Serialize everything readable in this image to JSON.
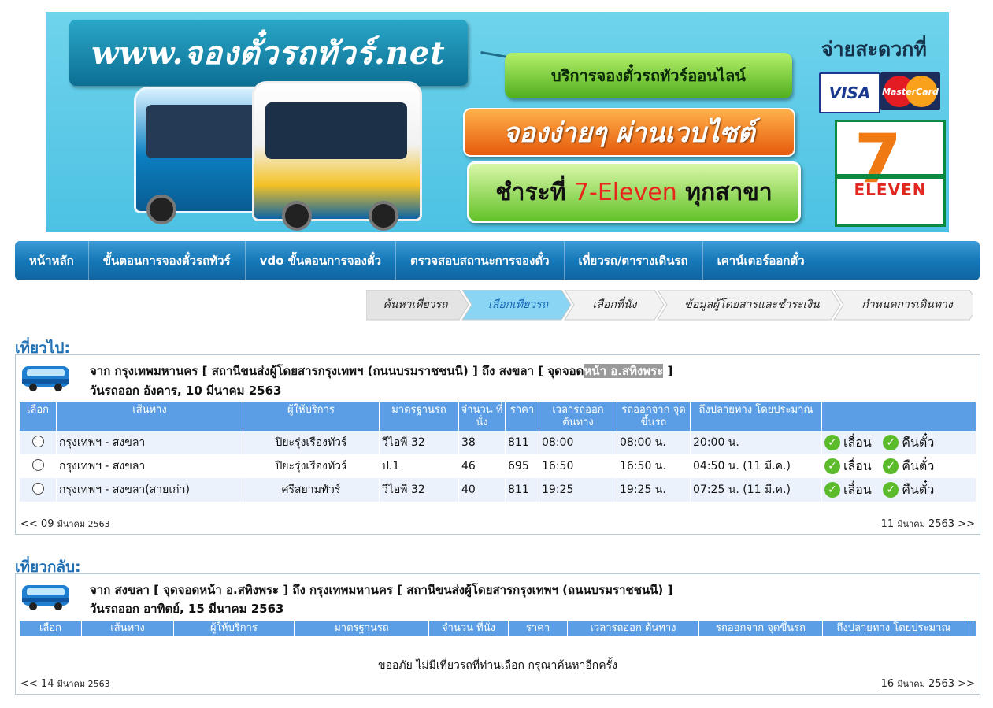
{
  "banner": {
    "site_name": "www.จองตั๋วรถทัวร์.net",
    "promo_service": "บริการจองตั๋วรถทัวร์ออนไลน์",
    "promo_easy": "จองง่ายๆ ผ่านเวบไซต์",
    "promo_pay_prefix": "ชำระที่",
    "promo_pay_store": "7-Eleven",
    "promo_pay_suffix": "ทุกสาขา",
    "pay_title": "จ่ายสะดวกที่",
    "card_visa": "VISA",
    "card_mastercard": "MasterCard",
    "seven_number": "7",
    "seven_name": "ELEVEN"
  },
  "nav": {
    "items": [
      "หน้าหลัก",
      "ขั้นตอนการจองตั๋วรถทัวร์",
      "vdo ขั้นตอนการจองตั๋ว",
      "ตรวจสอบสถานะการจองตั๋ว",
      "เที่ยวรถ/ตารางเดินรถ",
      "เคาน์เตอร์ออกตั๋ว"
    ]
  },
  "steps": [
    "ค้นหาเที่ยวรถ",
    "เลือกเที่ยวรถ",
    "เลือกที่นั่ง",
    "ข้อมูลผู้โดยสารและชำระเงิน",
    "กำหนดการเดินทาง"
  ],
  "outbound": {
    "title": "เที่ยวไป:",
    "route_prefix": "จาก กรุงเทพมหานคร [ สถานีขนส่งผู้โดยสารกรุงเทพฯ (ถนนบรมราชชนนี) ] ถึง สงขลา [ จุดจอด",
    "route_highlight": "หน้า อ.สทิงพระ",
    "route_suffix": " ]",
    "date": "วันรถออก อังคาร, 10 มีนาคม 2563",
    "headers": [
      "เลือก",
      "เส้นทาง",
      "ผู้ให้บริการ",
      "มาตรฐานรถ",
      "จำนวน ที่นั่ง",
      "ราคา",
      "เวลารถออก ต้นทาง",
      "รถออกจาก จุดขึ้นรถ",
      "ถึงปลายทาง โดยประมาณ",
      ""
    ],
    "rows": [
      {
        "route": "กรุงเทพฯ - สงขลา",
        "operator": "ปิยะรุ่งเรืองทัวร์",
        "standard": "วีไอพี 32",
        "seats": "38",
        "price": "811",
        "depart": "08:00",
        "board": "08:00 น.",
        "arrive": "20:00 น."
      },
      {
        "route": "กรุงเทพฯ - สงขลา",
        "operator": "ปิยะรุ่งเรืองทัวร์",
        "standard": "ป.1",
        "seats": "46",
        "price": "695",
        "depart": "16:50",
        "board": "16:50 น.",
        "arrive": "04:50 น. (11 มี.ค.)"
      },
      {
        "route": "กรุงเทพฯ - สงขลา(สายเก่า)",
        "operator": "ศรีสยามทัวร์",
        "standard": "วีไอพี 32",
        "seats": "40",
        "price": "811",
        "depart": "19:25",
        "board": "19:25 น.",
        "arrive": "07:25 น. (11 มี.ค.)"
      }
    ],
    "action_postpone": "เลื่อน",
    "action_refund": "คืนตั๋ว",
    "prev_prefix": "<< 09",
    "prev_month": "มีนาคม 2563",
    "next_day": "11",
    "next_month": "มีนาคม",
    "next_suffix": "2563 >>"
  },
  "inbound": {
    "title": "เที่ยวกลับ:",
    "route": "จาก สงขลา [ จุดจอดหน้า อ.สทิงพระ ] ถึง กรุงเทพมหานคร [ สถานีขนส่งผู้โดยสารกรุงเทพฯ (ถนนบรมราชชนนี) ]",
    "date": "วันรถออก อาทิตย์, 15 มีนาคม 2563",
    "headers": [
      "เลือก",
      "เส้นทาง",
      "ผู้ให้บริการ",
      "มาตรฐานรถ",
      "จำนวน ที่นั่ง",
      "ราคา",
      "เวลารถออก ต้นทาง",
      "รถออกจาก จุดขึ้นรถ",
      "ถึงปลายทาง โดยประมาณ",
      ""
    ],
    "no_result": "ขออภัย ไม่มีเที่ยวรถที่ท่านเลือก กรุณาค้นหาอีกครั้ง",
    "prev_prefix": "<< 14",
    "prev_month": "มีนาคม 2563",
    "next_day": "16",
    "next_month": "มีนาคม",
    "next_suffix": "2563 >>"
  },
  "colors": {
    "nav_blue": "#1678b9",
    "section_title": "#1f6fb3",
    "table_header": "#5b9ee6",
    "row_alt": "#ebf2fb",
    "step_active": "#8ad5f3",
    "check_green": "#5cbb2a"
  },
  "icons": [
    "bus-icon",
    "check-circle-icon",
    "radio-icon"
  ]
}
